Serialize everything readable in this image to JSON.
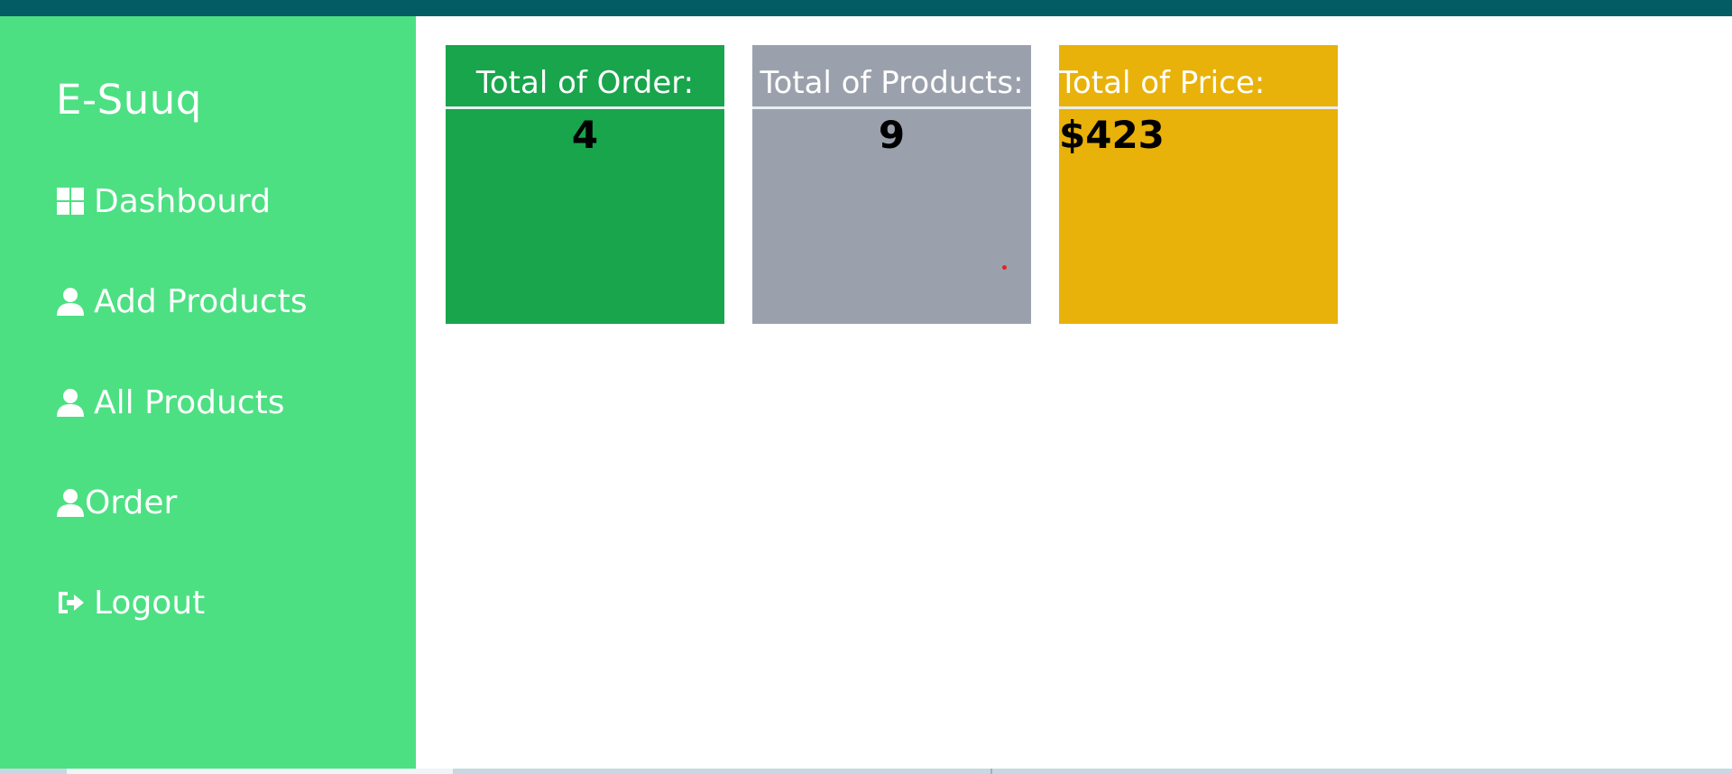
{
  "app": {
    "brand": "E-Suuq"
  },
  "sidebar": {
    "items": [
      {
        "label": "Dashbourd",
        "icon": "grid-icon"
      },
      {
        "label": "Add Products",
        "icon": "user-icon"
      },
      {
        "label": "All Products",
        "icon": "user-icon"
      },
      {
        "label": "Order",
        "icon": "user-icon"
      },
      {
        "label": "Logout",
        "icon": "sign-out-icon"
      }
    ]
  },
  "cards": [
    {
      "title": "Total of Order:",
      "value": "4",
      "color": "#18a54c"
    },
    {
      "title": "Total of Products:",
      "value": "9",
      "color": "#9ba1ac"
    },
    {
      "title": "Total of Price:",
      "value": "$423",
      "color": "#e9b20a"
    }
  ],
  "colors": {
    "topbar": "#035b64",
    "sidebar": "#4ce082",
    "text_on_sidebar": "#ffffff"
  }
}
